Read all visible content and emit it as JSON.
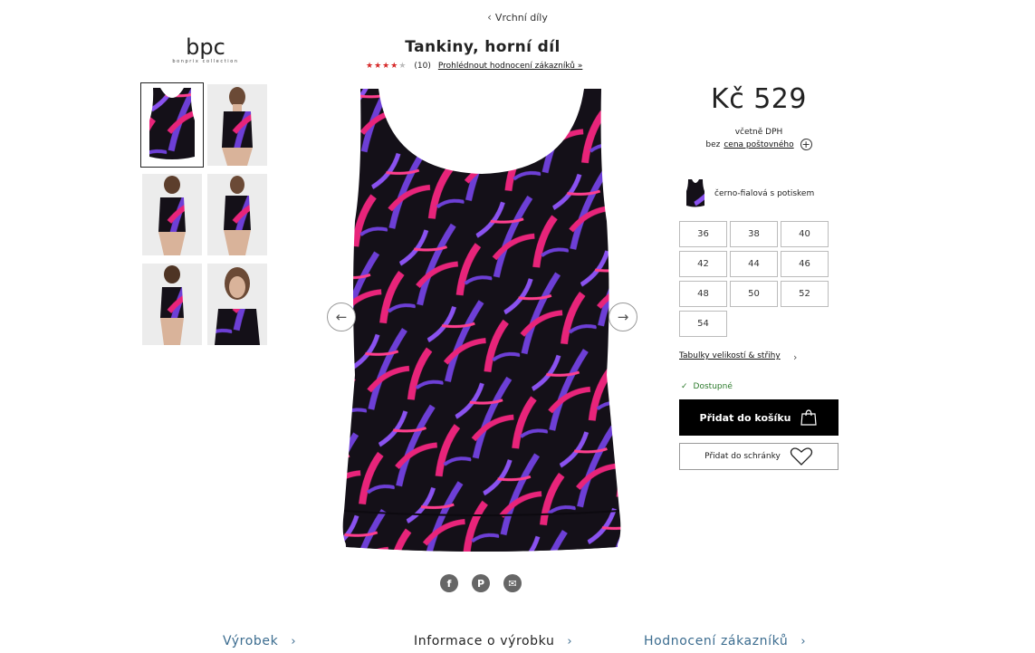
{
  "breadcrumb": {
    "label": "Vrchní díly"
  },
  "brand": {
    "logo": "bpc",
    "tagline": "bonprix collection"
  },
  "product": {
    "title": "Tankiny, horní díl",
    "rating_filled": 4,
    "rating_max": 5,
    "review_count": "(10)",
    "reviews_link": "Prohlédnout hodnocení zákazníků »"
  },
  "thumbnails": [
    {
      "name": "thumb-front",
      "active": true
    },
    {
      "name": "thumb-model-front"
    },
    {
      "name": "thumb-model-back"
    },
    {
      "name": "thumb-model-side"
    },
    {
      "name": "thumb-model-back-2"
    },
    {
      "name": "thumb-model-closeup"
    }
  ],
  "gallery": {
    "prev_icon": "arrow-left-icon",
    "next_icon": "arrow-right-icon"
  },
  "social": [
    {
      "name": "facebook-icon",
      "glyph": "f"
    },
    {
      "name": "pinterest-icon",
      "glyph": "P"
    },
    {
      "name": "email-icon",
      "glyph": "✉"
    }
  ],
  "pricing": {
    "price": "Kč 529",
    "vat": "včetně DPH",
    "shipping_prefix": "bez",
    "shipping_link": "cena poštovného"
  },
  "color": {
    "label": "černo-fialová s potiskem"
  },
  "sizes": [
    "36",
    "38",
    "40",
    "42",
    "44",
    "46",
    "48",
    "50",
    "52",
    "54"
  ],
  "size_chart": {
    "label": "Tabulky velikostí & střihy"
  },
  "availability": {
    "label": "Dostupné"
  },
  "actions": {
    "add_to_cart": "Přidat do košíku",
    "add_to_wishlist": "Přidat do schránky"
  },
  "bottom_tabs": [
    {
      "label": "Výrobek",
      "color": "#3b6c8f"
    },
    {
      "label": "Informace o výrobku",
      "color": "#222222"
    },
    {
      "label": "Hodnocení zákazníků",
      "color": "#3b6c8f"
    }
  ],
  "colors": {
    "accent": "#000000",
    "star": "#d62828",
    "available": "#2b7a2b",
    "link_tab": "#3b6c8f"
  }
}
